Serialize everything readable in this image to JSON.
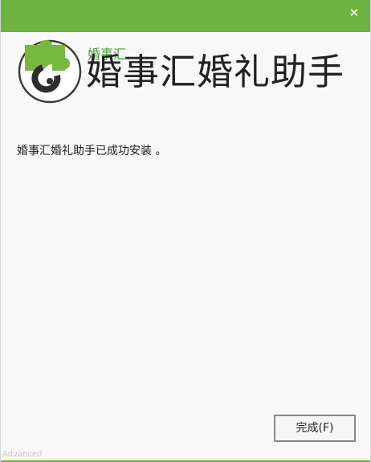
{
  "window": {
    "close_symbol": "✕"
  },
  "header": {
    "brand_small": "婚事汇",
    "app_title": "婚事汇婚礼助手",
    "logo_icon": "puzzle-logo-icon"
  },
  "main": {
    "message": "婚事汇婚礼助手已成功安装 。"
  },
  "footer": {
    "finish_label": "完成(F)",
    "advanced_label": "Advanced"
  },
  "colors": {
    "accent": "#6db33f",
    "logo_circle": "#3a3a3a",
    "brand_green": "#3f9e2a"
  }
}
